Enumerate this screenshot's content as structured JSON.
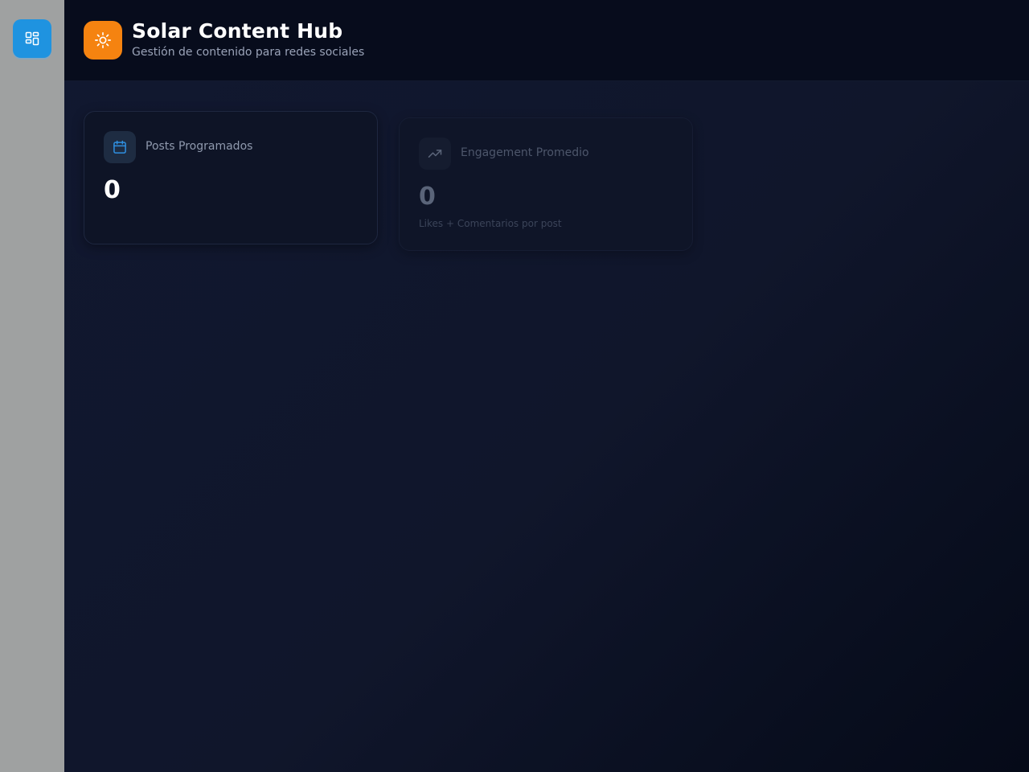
{
  "header": {
    "title": "Solar Content Hub",
    "subtitle": "Gestión de contenido para redes sociales",
    "logo_icon": "sun-icon",
    "logo_color": "#f58310"
  },
  "sidebar": {
    "button_icon": "dashboard-grid-icon",
    "button_color": "#1f93e0"
  },
  "stats": [
    {
      "label": "Posts Programados",
      "value": "0",
      "icon": "calendar-icon"
    },
    {
      "label": "Engagement Promedio",
      "value": "0",
      "subtitle": "Likes + Comentarios por post",
      "icon": "trending-up-icon"
    }
  ]
}
